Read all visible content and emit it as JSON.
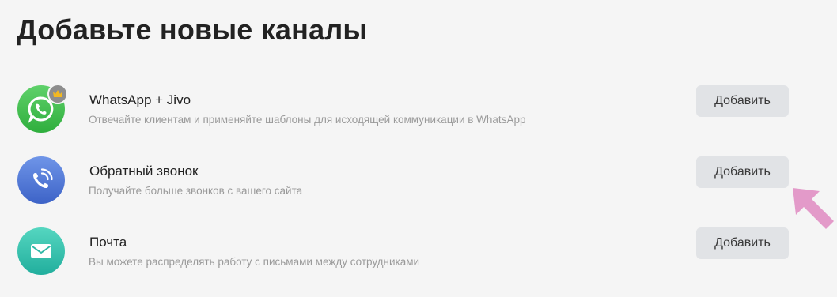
{
  "page": {
    "title": "Добавьте новые каналы"
  },
  "channels": [
    {
      "name": "WhatsApp + Jivo",
      "description": "Отвечайте клиентам и применяйте шаблоны для исходящей коммуникации в WhatsApp",
      "icon": "whatsapp-icon",
      "badge": "crown-icon",
      "button": "Добавить"
    },
    {
      "name": "Обратный звонок",
      "description": "Получайте больше звонков с вашего сайта",
      "icon": "phone-call-icon",
      "button": "Добавить"
    },
    {
      "name": "Почта",
      "description": "Вы можете распределять работу с письмами между сотрудниками",
      "icon": "envelope-icon",
      "button": "Добавить"
    }
  ],
  "colors": {
    "background": "#f5f5f5",
    "whatsapp": "#3cba4a",
    "callback": "#4f74d6",
    "mail": "#2fc0ac",
    "button_bg": "#e1e3e6",
    "annotation_arrow": "#e39ac9"
  }
}
